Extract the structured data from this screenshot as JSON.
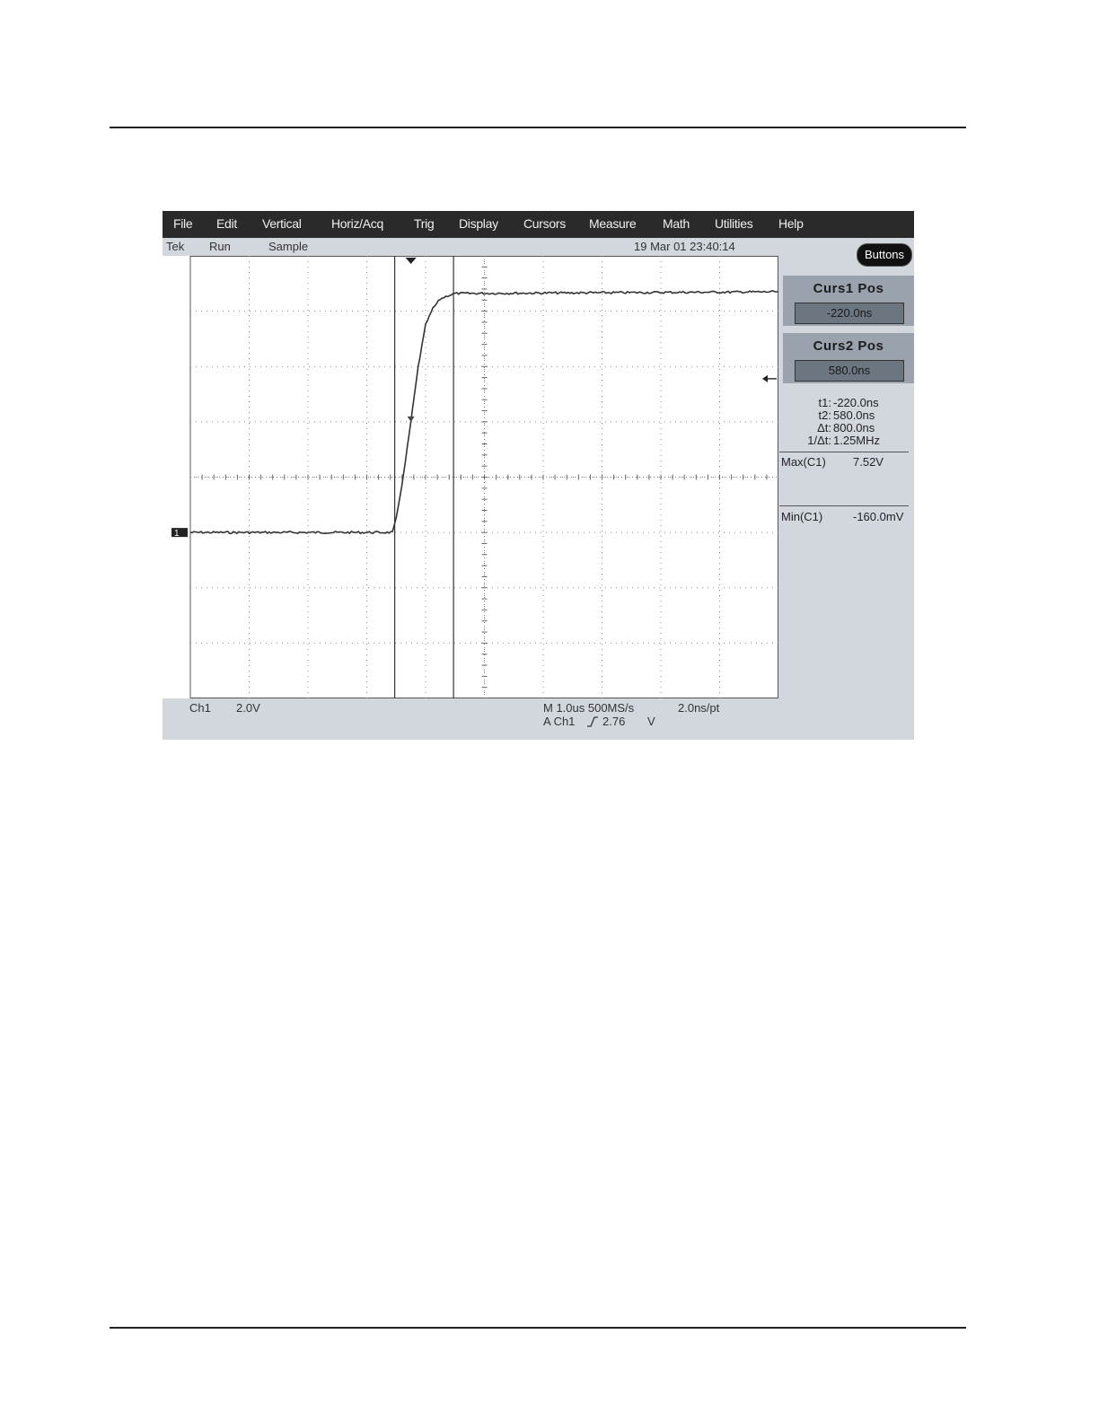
{
  "menubar": {
    "items": [
      "File",
      "Edit",
      "Vertical",
      "Horiz/Acq",
      "Trig",
      "Display",
      "Cursors",
      "Measure",
      "Math",
      "Utilities",
      "Help"
    ]
  },
  "status": {
    "brand": "Tek",
    "run_state": "Run",
    "acq_mode": "Sample",
    "datetime": "19 Mar 01 23:40:14"
  },
  "sidepanel": {
    "buttons_label": "Buttons",
    "curs1": {
      "title": "Curs1 Pos",
      "value": "-220.0ns"
    },
    "curs2": {
      "title": "Curs2 Pos",
      "value": "580.0ns"
    },
    "readouts": {
      "t1_label": "t1:",
      "t1_value": "-220.0ns",
      "t2_label": "t2:",
      "t2_value": "580.0ns",
      "dt_label": "Δt:",
      "dt_value": "800.0ns",
      "inv_label": "1/Δt:",
      "inv_value": "1.25MHz"
    },
    "measurements": [
      {
        "label": "Max(C1)",
        "value": "7.52V"
      },
      {
        "label": "Min(C1)",
        "value": "-160.0mV"
      }
    ]
  },
  "bottom": {
    "channel": "Ch1",
    "volts_div": "2.0V",
    "timebase": "M 1.0us 500MS/s",
    "resolution": "2.0ns/pt",
    "trigger": "A Ch1",
    "trigger_slope_icon": "rising-edge-icon",
    "trigger_level": "2.76",
    "trigger_unit": "V"
  },
  "markers": {
    "channel_marker": "1"
  },
  "chart_data": {
    "type": "line",
    "x_unit": "us",
    "y_unit": "V",
    "xlim": [
      -3.0,
      5.0
    ],
    "ylim": [
      -7.0,
      1.0
    ],
    "cursor1_us": -0.22,
    "cursor2_us": 0.58,
    "series": [
      {
        "x": [
          -3.0,
          -0.25,
          -0.2,
          -0.1,
          0.0,
          0.1,
          0.2,
          0.3,
          0.4,
          0.5,
          0.6,
          5.0
        ],
        "y": [
          -4.0,
          -4.0,
          -3.75,
          -2.96,
          -2.0,
          -1.0,
          -0.25,
          0.05,
          0.22,
          0.28,
          0.32,
          0.35
        ]
      }
    ],
    "grid": true
  }
}
